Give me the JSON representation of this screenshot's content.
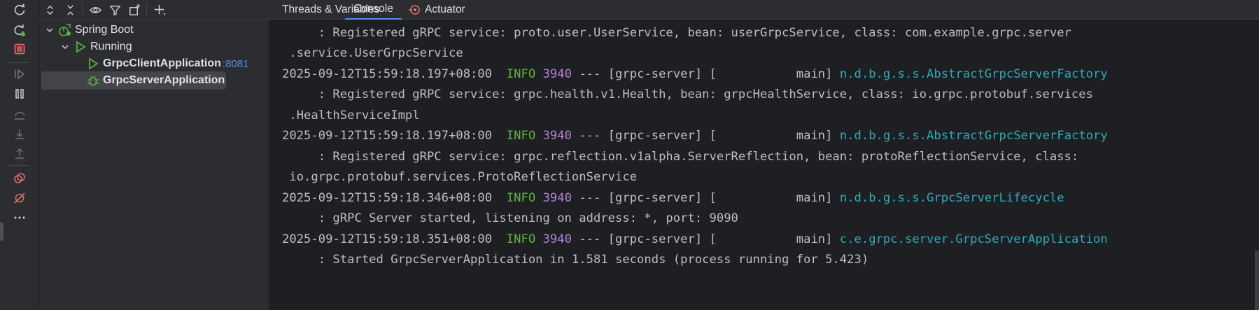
{
  "tree_toolbar": {
    "icons": [
      "expand-all-icon",
      "collapse-all-icon",
      "eye-icon",
      "filter-icon",
      "new-tab-icon",
      "add-icon"
    ]
  },
  "left_toolbar": {
    "icons": [
      "rerun-icon",
      "rerun-debug-icon",
      "stop-icon",
      "resume-icon",
      "pause-icon",
      "step-over-icon",
      "step-into-icon",
      "step-out-icon",
      "breakpoints-icon",
      "mute-breakpoints-icon",
      "more-icon"
    ]
  },
  "tree": {
    "root_label": "Spring Boot",
    "group_label": "Running",
    "items": [
      {
        "label": "GrpcClientApplication",
        "port": ":8081"
      },
      {
        "label": "GrpcServerApplication"
      }
    ]
  },
  "tabs": [
    {
      "label": "Threads & Variables"
    },
    {
      "label": "Console"
    },
    {
      "label": "Actuator"
    }
  ],
  "console": {
    "lines": [
      {
        "kind": "text",
        "text": "     : Registered gRPC service: proto.user.UserService, bean: userGrpcService, class: com.example.grpc.server"
      },
      {
        "kind": "text",
        "text": " .service.UserGrpcService"
      },
      {
        "kind": "log",
        "ts": "2025-09-12T15:59:18.197+08:00",
        "level": "INFO",
        "pid": "3940",
        "thread": " --- [grpc-server] [           main] ",
        "logger": "n.d.b.g.s.s.AbstractGrpcServerFactory"
      },
      {
        "kind": "text",
        "text": "     : Registered gRPC service: grpc.health.v1.Health, bean: grpcHealthService, class: io.grpc.protobuf.services"
      },
      {
        "kind": "text",
        "text": " .HealthServiceImpl"
      },
      {
        "kind": "log",
        "ts": "2025-09-12T15:59:18.197+08:00",
        "level": "INFO",
        "pid": "3940",
        "thread": " --- [grpc-server] [           main] ",
        "logger": "n.d.b.g.s.s.AbstractGrpcServerFactory"
      },
      {
        "kind": "text",
        "text": "     : Registered gRPC service: grpc.reflection.v1alpha.ServerReflection, bean: protoReflectionService, class:"
      },
      {
        "kind": "text",
        "text": " io.grpc.protobuf.services.ProtoReflectionService"
      },
      {
        "kind": "log",
        "ts": "2025-09-12T15:59:18.346+08:00",
        "level": "INFO",
        "pid": "3940",
        "thread": " --- [grpc-server] [           main] ",
        "logger": "n.d.b.g.s.s.GrpcServerLifecycle"
      },
      {
        "kind": "text",
        "text": "     : gRPC Server started, listening on address: *, port: 9090"
      },
      {
        "kind": "log",
        "ts": "2025-09-12T15:59:18.351+08:00",
        "level": "INFO",
        "pid": "3940",
        "thread": " --- [grpc-server] [           main] ",
        "logger": "c.e.grpc.server.GrpcServerApplication"
      },
      {
        "kind": "text",
        "text": "     : Started GrpcServerApplication in 1.581 seconds (process running for 5.423)"
      }
    ]
  },
  "colors": {
    "panel": "#2b2d30",
    "console_bg": "#1e1f22",
    "info": "#5fb040",
    "pid": "#b282d6",
    "logger": "#2aacb8",
    "accent": "#548af7"
  }
}
